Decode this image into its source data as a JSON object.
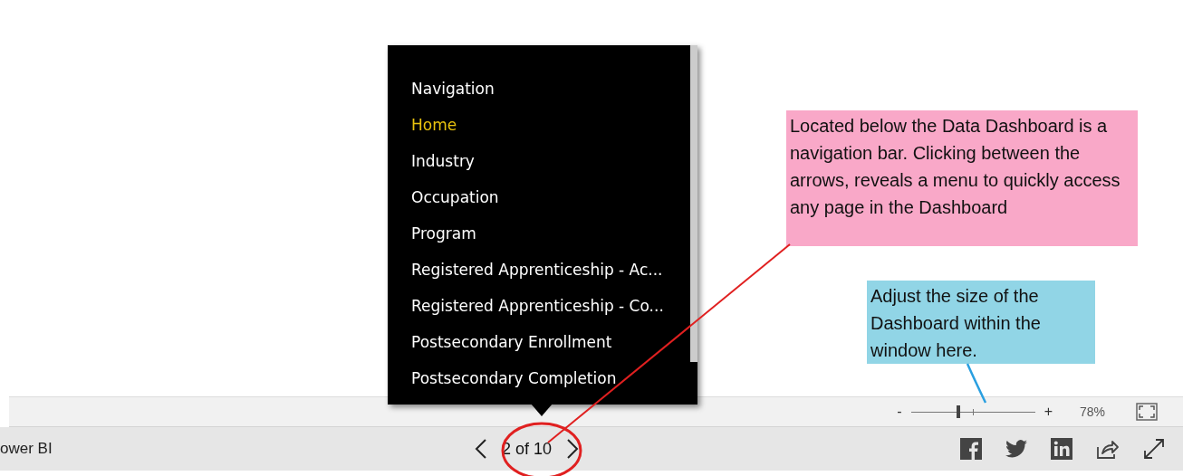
{
  "page_menu": {
    "title": "Navigation",
    "items": [
      {
        "label": "Home",
        "selected": true
      },
      {
        "label": "Industry",
        "selected": false
      },
      {
        "label": "Occupation",
        "selected": false
      },
      {
        "label": "Program",
        "selected": false
      },
      {
        "label": "Registered Apprenticeship - Ac...",
        "selected": false
      },
      {
        "label": "Registered Apprenticeship - Co...",
        "selected": false
      },
      {
        "label": "Postsecondary Enrollment",
        "selected": false
      },
      {
        "label": "Postsecondary Completion",
        "selected": false
      }
    ]
  },
  "zoom_bar": {
    "minus": "-",
    "plus": "+",
    "level": 0.38,
    "reading": "78%"
  },
  "nav_bar": {
    "brand": "ower BI",
    "page_indicator": "2 of 10"
  },
  "callouts": [
    {
      "text": "Located below the Data Dashboard is a navigation bar. Clicking between the arrows, reveals a menu to quickly access any page in the Dashboard",
      "color": "#f9a8c8"
    },
    {
      "text": "Adjust the size of the Dashboard within the window here.",
      "color": "#91d5e6"
    }
  ]
}
